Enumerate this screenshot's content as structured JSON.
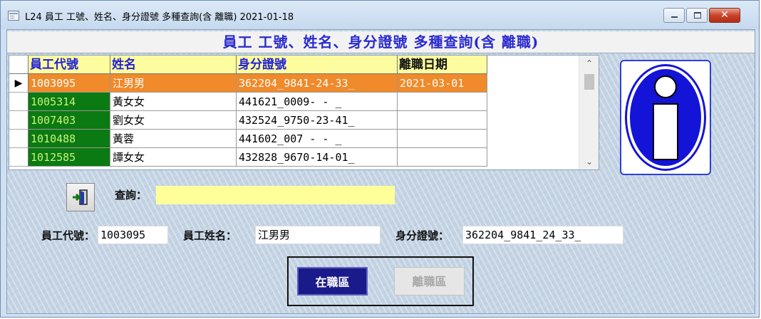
{
  "window": {
    "title": "L24 員工 工號、姓名、身分證號 多種查詢(含 離職) 2021-01-18",
    "close_glyph": "✕"
  },
  "header": {
    "title": "員工 工號、姓名、身分證號 多種查詢(含 離職)"
  },
  "grid": {
    "columns": [
      "員工代號",
      "姓名",
      "身分證號",
      "離職日期"
    ],
    "selected_indicator": "▶",
    "rows": [
      {
        "code": "1003095",
        "name": "江男男",
        "id": "362204_9841-24-33_",
        "leave_date": "2021-03-01"
      },
      {
        "code": "1005314",
        "name": "黃女女",
        "id": "441621_0009-  -  _",
        "leave_date": ""
      },
      {
        "code": "1007403",
        "name": "劉女女",
        "id": "432524_9750-23-41_",
        "leave_date": ""
      },
      {
        "code": "1010488",
        "name": "黃蓉",
        "id": "441602_007 -  -  _",
        "leave_date": ""
      },
      {
        "code": "1012585",
        "name": "譚女女",
        "id": "432828_9670-14-01_",
        "leave_date": ""
      }
    ],
    "scroll_up": "⌃",
    "scroll_down": "⌄"
  },
  "query": {
    "label": "查詢：",
    "value": ""
  },
  "detail": {
    "code_label": "員工代號：",
    "code_value": "1003095",
    "name_label": "員工姓名：",
    "name_value": "江男男",
    "id_label": "身分證號：",
    "id_value": "362204_9841_24_33_"
  },
  "buttons": {
    "active_label": "在職區",
    "inactive_label": "離職區"
  },
  "colors": {
    "header_title": "#2a2ad0",
    "grid_header_bg": "#fdfd9f",
    "code_cell_bg": "#0b7a12",
    "code_cell_text": "#c8f27a",
    "selected_row_bg": "#f08a2a",
    "query_input_bg": "#ffff9a",
    "active_button_bg": "#1a1a8a"
  },
  "icons": [
    "app-window-icon",
    "minimize-icon",
    "maximize-icon",
    "close-icon",
    "info-icon",
    "exit-door-icon"
  ]
}
